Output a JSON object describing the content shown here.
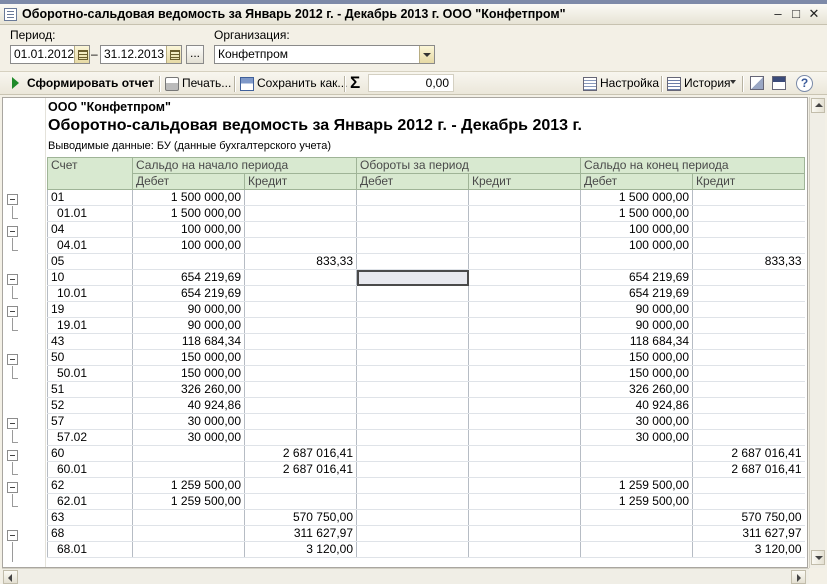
{
  "window": {
    "title": "Оборотно-сальдовая ведомость за Январь 2012 г. - Декабрь 2013 г. ООО \"Конфетпром\""
  },
  "filters": {
    "period_label": "Период:",
    "date_from": "01.01.2012",
    "dash": "–",
    "date_to": "31.12.2013",
    "dots": "...",
    "org_label": "Организация:",
    "org_value": "Конфетпром"
  },
  "toolbar": {
    "generate": "Сформировать отчет",
    "print": "Печать...",
    "save": "Сохранить как...",
    "sum_symbol": "Σ",
    "sum_value": "0,00",
    "settings": "Настройка",
    "history": "История",
    "help": "?"
  },
  "report": {
    "org_name": "ООО \"Конфетпром\"",
    "title": "Оборотно-сальдовая ведомость за Январь 2012 г. - Декабрь 2013 г.",
    "params": "Выводимые данные:  БУ (данные бухгалтерского учета)",
    "headers": {
      "account": "Счет",
      "opening": "Сальдо на начало периода",
      "turnover": "Обороты за период",
      "closing": "Сальдо на конец периода",
      "debit": "Дебет",
      "credit": "Кредит"
    },
    "rows": [
      {
        "acc": "01",
        "sub": false,
        "od": "1 500 000,00",
        "oc": "",
        "td": "",
        "tc": "",
        "cd": "1 500 000,00",
        "cc": ""
      },
      {
        "acc": "01.01",
        "sub": true,
        "od": "1 500 000,00",
        "oc": "",
        "td": "",
        "tc": "",
        "cd": "1 500 000,00",
        "cc": ""
      },
      {
        "acc": "04",
        "sub": false,
        "od": "100 000,00",
        "oc": "",
        "td": "",
        "tc": "",
        "cd": "100 000,00",
        "cc": ""
      },
      {
        "acc": "04.01",
        "sub": true,
        "od": "100 000,00",
        "oc": "",
        "td": "",
        "tc": "",
        "cd": "100 000,00",
        "cc": ""
      },
      {
        "acc": "05",
        "sub": false,
        "od": "",
        "oc": "833,33",
        "td": "",
        "tc": "",
        "cd": "",
        "cc": "833,33"
      },
      {
        "acc": "10",
        "sub": false,
        "od": "654 219,69",
        "oc": "",
        "td": "",
        "tc": "",
        "cd": "654 219,69",
        "cc": ""
      },
      {
        "acc": "10.01",
        "sub": true,
        "od": "654 219,69",
        "oc": "",
        "td": "",
        "tc": "",
        "cd": "654 219,69",
        "cc": ""
      },
      {
        "acc": "19",
        "sub": false,
        "od": "90 000,00",
        "oc": "",
        "td": "",
        "tc": "",
        "cd": "90 000,00",
        "cc": ""
      },
      {
        "acc": "19.01",
        "sub": true,
        "od": "90 000,00",
        "oc": "",
        "td": "",
        "tc": "",
        "cd": "90 000,00",
        "cc": ""
      },
      {
        "acc": "43",
        "sub": false,
        "od": "118 684,34",
        "oc": "",
        "td": "",
        "tc": "",
        "cd": "118 684,34",
        "cc": ""
      },
      {
        "acc": "50",
        "sub": false,
        "od": "150 000,00",
        "oc": "",
        "td": "",
        "tc": "",
        "cd": "150 000,00",
        "cc": ""
      },
      {
        "acc": "50.01",
        "sub": true,
        "od": "150 000,00",
        "oc": "",
        "td": "",
        "tc": "",
        "cd": "150 000,00",
        "cc": ""
      },
      {
        "acc": "51",
        "sub": false,
        "od": "326 260,00",
        "oc": "",
        "td": "",
        "tc": "",
        "cd": "326 260,00",
        "cc": ""
      },
      {
        "acc": "52",
        "sub": false,
        "od": "40 924,86",
        "oc": "",
        "td": "",
        "tc": "",
        "cd": "40 924,86",
        "cc": ""
      },
      {
        "acc": "57",
        "sub": false,
        "od": "30 000,00",
        "oc": "",
        "td": "",
        "tc": "",
        "cd": "30 000,00",
        "cc": ""
      },
      {
        "acc": "57.02",
        "sub": true,
        "od": "30 000,00",
        "oc": "",
        "td": "",
        "tc": "",
        "cd": "30 000,00",
        "cc": ""
      },
      {
        "acc": "60",
        "sub": false,
        "od": "",
        "oc": "2 687 016,41",
        "td": "",
        "tc": "",
        "cd": "",
        "cc": "2 687 016,41"
      },
      {
        "acc": "60.01",
        "sub": true,
        "od": "",
        "oc": "2 687 016,41",
        "td": "",
        "tc": "",
        "cd": "",
        "cc": "2 687 016,41"
      },
      {
        "acc": "62",
        "sub": false,
        "od": "1 259 500,00",
        "oc": "",
        "td": "",
        "tc": "",
        "cd": "1 259 500,00",
        "cc": ""
      },
      {
        "acc": "62.01",
        "sub": true,
        "od": "1 259 500,00",
        "oc": "",
        "td": "",
        "tc": "",
        "cd": "1 259 500,00",
        "cc": ""
      },
      {
        "acc": "63",
        "sub": false,
        "od": "",
        "oc": "570 750,00",
        "td": "",
        "tc": "",
        "cd": "",
        "cc": "570 750,00"
      },
      {
        "acc": "68",
        "sub": false,
        "od": "",
        "oc": "311 627,97",
        "td": "",
        "tc": "",
        "cd": "",
        "cc": "311 627,97"
      },
      {
        "acc": "68.01",
        "sub": true,
        "od": "",
        "oc": "3 120,00",
        "td": "",
        "tc": "",
        "cd": "",
        "cc": "3 120,00"
      }
    ]
  }
}
